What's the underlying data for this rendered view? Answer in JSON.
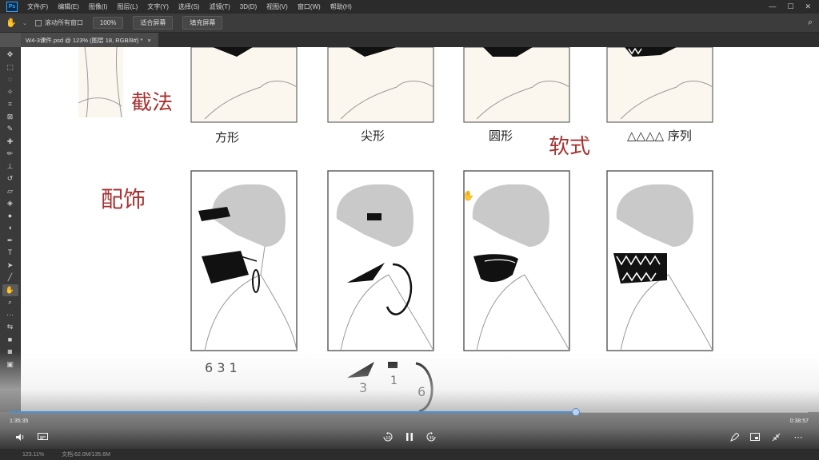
{
  "app": {
    "logo": "Ps",
    "menus": [
      "文件(F)",
      "编辑(E)",
      "图像(I)",
      "图层(L)",
      "文字(Y)",
      "选择(S)",
      "滤镜(T)",
      "3D(D)",
      "视图(V)",
      "窗口(W)",
      "帮助(H)"
    ],
    "window_controls": [
      "—",
      "☐",
      "✕"
    ]
  },
  "options_bar": {
    "scroll_all_label": "滚动所有窗口",
    "zoom_value": "100%",
    "fit_screen_label": "适合屏幕",
    "fill_screen_label": "填充屏幕"
  },
  "document_tab": {
    "title": "W4-3课件.psd @ 123% (图层 18, RGB/8#) *",
    "close": "×"
  },
  "toolbar": {
    "tools": [
      {
        "icon": "move-icon",
        "glyph": "✥"
      },
      {
        "icon": "marquee-icon",
        "glyph": "⬚"
      },
      {
        "icon": "lasso-icon",
        "glyph": "◌"
      },
      {
        "icon": "magic-wand-icon",
        "glyph": "✧"
      },
      {
        "icon": "crop-icon",
        "glyph": "⌗"
      },
      {
        "icon": "frame-icon",
        "glyph": "⊠"
      },
      {
        "icon": "eyedropper-icon",
        "glyph": "✎"
      },
      {
        "icon": "healing-brush-icon",
        "glyph": "✚"
      },
      {
        "icon": "brush-icon",
        "glyph": "✏"
      },
      {
        "icon": "clone-stamp-icon",
        "glyph": "⊥"
      },
      {
        "icon": "history-brush-icon",
        "glyph": "↺"
      },
      {
        "icon": "eraser-icon",
        "glyph": "▱"
      },
      {
        "icon": "paint-bucket-icon",
        "glyph": "◈"
      },
      {
        "icon": "blur-icon",
        "glyph": "●"
      },
      {
        "icon": "dodge-icon",
        "glyph": "◖"
      },
      {
        "icon": "pen-icon",
        "glyph": "✒"
      },
      {
        "icon": "type-icon",
        "glyph": "T"
      },
      {
        "icon": "path-selection-icon",
        "glyph": "➤"
      },
      {
        "icon": "line-icon",
        "glyph": "╱"
      },
      {
        "icon": "hand-icon",
        "glyph": "✋"
      },
      {
        "icon": "zoom-icon",
        "glyph": "⌕"
      },
      {
        "icon": "more-tools-icon",
        "glyph": "···"
      },
      {
        "icon": "swap-colors-icon",
        "glyph": "⇆"
      },
      {
        "icon": "color-swatches-icon",
        "glyph": "■"
      },
      {
        "icon": "quick-mask-icon",
        "glyph": "◙"
      },
      {
        "icon": "screen-mode-icon",
        "glyph": "▣"
      }
    ],
    "active_tool": "hand-icon"
  },
  "canvas": {
    "labels": {
      "cut_method": "截法",
      "square": "方形",
      "pointed": "尖形",
      "round": "圆形",
      "soft_style": "软式",
      "sequence": "△△△△ 序列",
      "decoration": "配饰",
      "order_top": "6 3 1",
      "num_3": "3",
      "num_1": "1",
      "num_6": "6"
    }
  },
  "player": {
    "current_time": "1:35:35",
    "total_time": "0:38:57",
    "progress": 0.709,
    "rewind_label": "10",
    "forward_label": "30"
  },
  "status_bar": {
    "zoom": "123.11%",
    "doc_size": "文档:62.0M/135.6M"
  },
  "colors": {
    "ink_red": "#a83232",
    "progress_blue": "#4a90d9",
    "mask_black": "#111111",
    "hair_gray": "#c9c9c9",
    "skin": "#fbf7ee"
  }
}
